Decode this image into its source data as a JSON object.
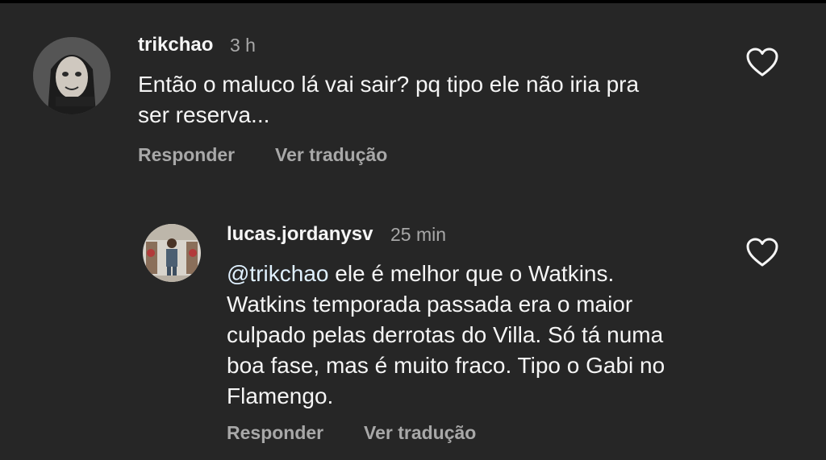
{
  "comments": [
    {
      "username": "trikchao",
      "time": "3 h",
      "text_lines": [
        "Então o maluco lá vai sair? pq tipo ele não iria pra",
        "ser reserva..."
      ],
      "reply_label": "Responder",
      "translate_label": "Ver tradução"
    },
    {
      "username": "lucas.jordanysv",
      "time": "25 min",
      "mention": "@trikchao",
      "text_lines_after_mention": [
        " ele é melhor que o Watkins.",
        "Watkins temporada passada era o maior",
        "culpado pelas derrotas do Villa. Só tá numa",
        "boa fase, mas é muito fraco. Tipo o Gabi no",
        "Flamengo."
      ],
      "reply_label": "Responder",
      "translate_label": "Ver tradução"
    }
  ],
  "icons": {
    "like": "heart-outline-icon"
  },
  "colors": {
    "background": "#262626",
    "primary_text": "#f5f5f5",
    "secondary_text": "#a8a8a8"
  }
}
